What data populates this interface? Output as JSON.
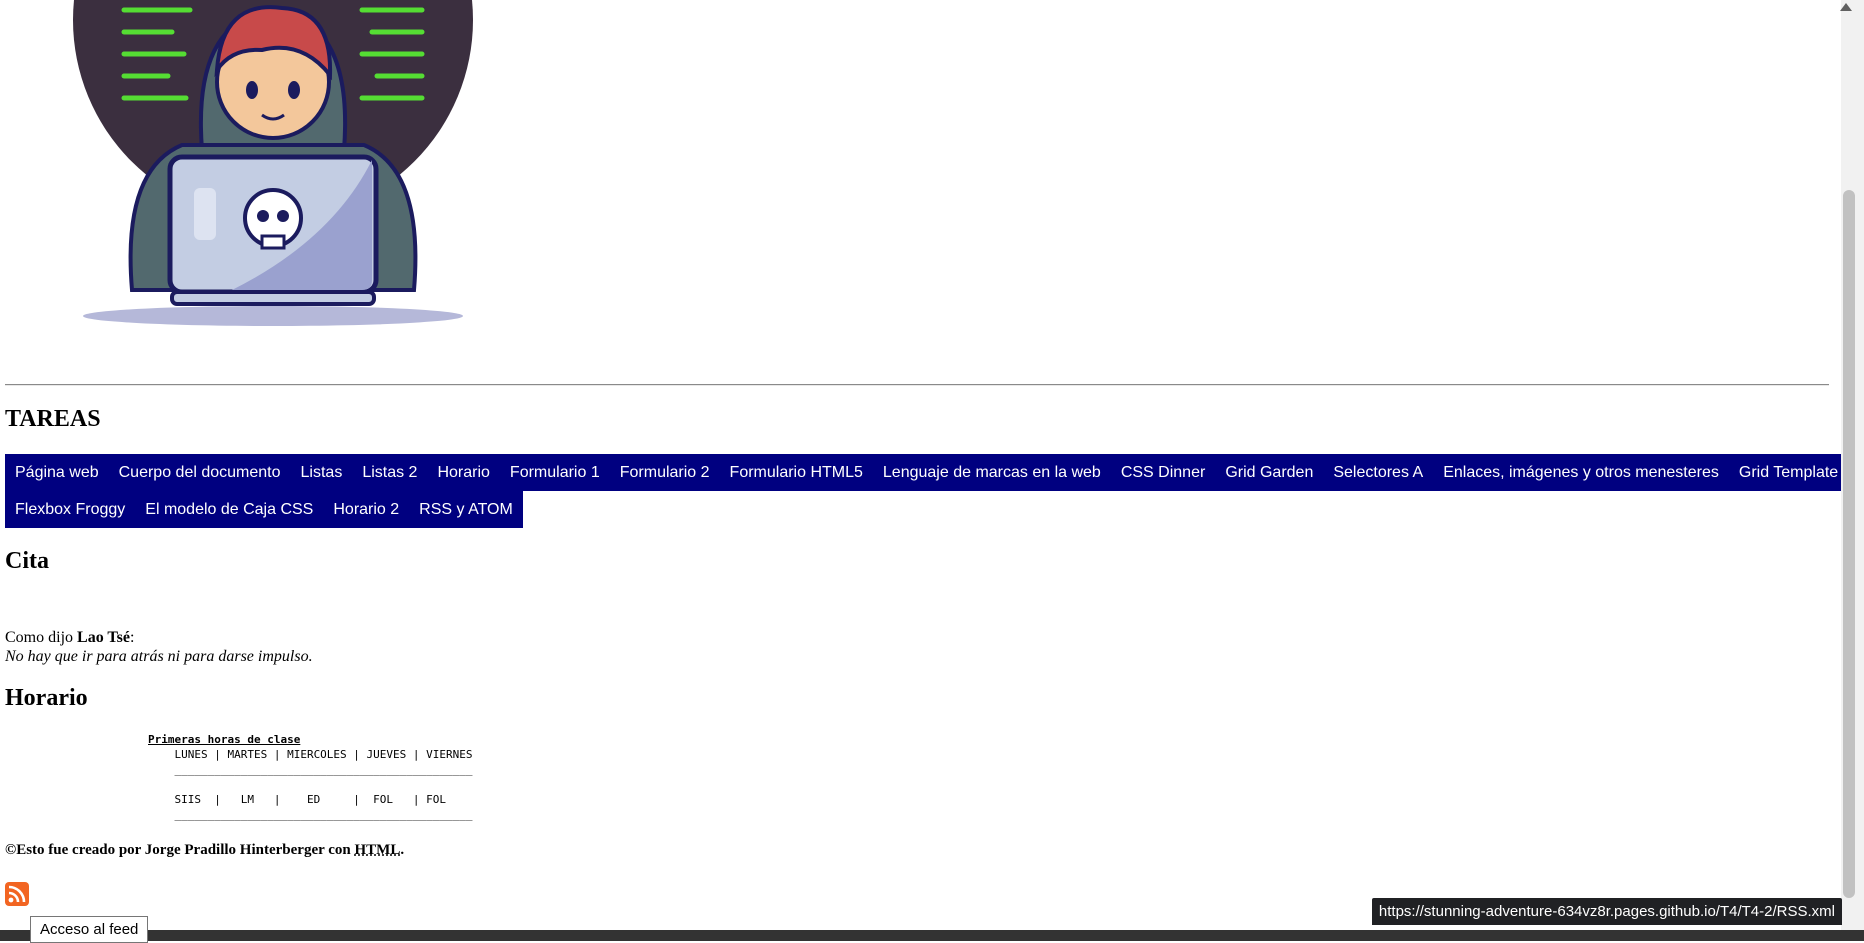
{
  "nav_heading": "TAREAS",
  "nav_row1": [
    "Página web",
    "Cuerpo del documento",
    "Listas",
    "Listas 2",
    "Horario",
    "Formulario 1",
    "Formulario 2",
    "Formulario HTML5",
    "Lenguaje de marcas en la web",
    "CSS Dinner",
    "Grid Garden",
    "Selectores A",
    "Enlaces, imágenes y otros menesteres",
    "Grid Template Areas"
  ],
  "nav_row2": [
    "Flexbox Froggy",
    "El modelo de Caja CSS",
    "Horario 2",
    "RSS y ATOM"
  ],
  "cita": {
    "heading": "Cita",
    "intro": "Como dijo ",
    "author": "Lao Tsé",
    "colon": ":",
    "quote": "No hay que ir para atrás ni para darse impulso."
  },
  "horario": {
    "heading": "Horario",
    "title": "Primeras horas de clase",
    "lines": [
      "    LUNES | MARTES | MIERCOLES | JUEVES | VIERNES",
      "    _____________________________________________",
      "",
      "    SIIS  |   LM   |    ED     |  FOL   | FOL",
      "    _____________________________________________"
    ]
  },
  "footer": {
    "text": "©Esto fue creado por Jorge Pradillo Hinterberger con ",
    "abbr": "HTML",
    "end": "."
  },
  "tooltip": "Acceso al feed",
  "status_url": "https://stunning-adventure-634vz8r.pages.github.io/T4/T4-2/RSS.xml",
  "colors": {
    "nav_bg": "#000080",
    "nav_text": "#ffffff",
    "status_bg": "#202124"
  }
}
